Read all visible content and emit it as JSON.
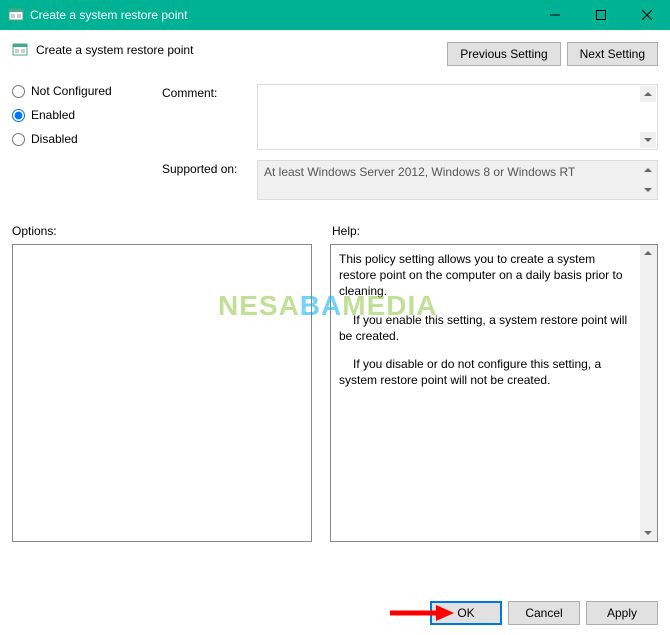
{
  "window": {
    "title": "Create a system restore point"
  },
  "header": {
    "page_title": "Create a system restore point",
    "previous_setting": "Previous Setting",
    "next_setting": "Next Setting"
  },
  "radios": {
    "not_configured": "Not Configured",
    "enabled": "Enabled",
    "disabled": "Disabled",
    "selected": "enabled"
  },
  "fields": {
    "comment_label": "Comment:",
    "comment_value": "",
    "supported_label": "Supported on:",
    "supported_value": "At least Windows Server 2012, Windows 8 or Windows RT"
  },
  "panels": {
    "options_label": "Options:",
    "help_label": "Help:",
    "help_p1": "This policy setting allows you to create a system restore point on the computer on a daily basis prior to cleaning.",
    "help_p2": "If you enable this setting, a system restore point will be created.",
    "help_p3": "If you disable or do not configure this setting, a system restore point will not be created."
  },
  "footer": {
    "ok": "OK",
    "cancel": "Cancel",
    "apply": "Apply"
  },
  "watermark": {
    "part1": "NESA",
    "part2": "BA",
    "part3": "MEDIA"
  }
}
